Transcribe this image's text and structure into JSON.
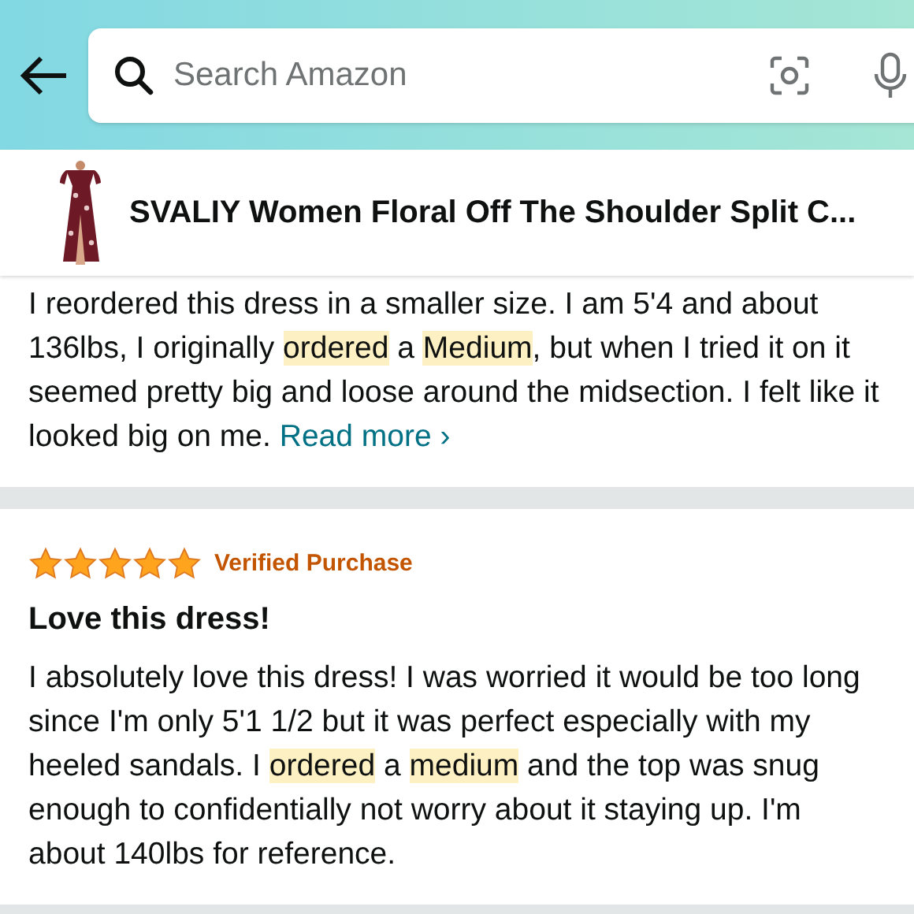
{
  "search": {
    "placeholder": "Search Amazon"
  },
  "product": {
    "title": "SVALIY Women Floral Off The Shoulder Split C..."
  },
  "reviews": [
    {
      "body": [
        {
          "text": "I reordered this dress in a smaller size. I am 5'4 and about 136lbs, I originally ",
          "highlight": false
        },
        {
          "text": "ordered",
          "highlight": true
        },
        {
          "text": " a ",
          "highlight": false
        },
        {
          "text": "Medium",
          "highlight": true
        },
        {
          "text": ", but when I tried it on it seemed pretty big and loose around the midsection. I felt like it looked big on me.",
          "highlight": false
        }
      ],
      "read_more": "Read more ›"
    },
    {
      "stars": 5,
      "badge": "Verified Purchase",
      "title": "Love this dress!",
      "body": [
        {
          "text": "I absolutely love this dress! I was worried it would be too long since I'm only 5'1 1/2 but it was perfect especially with my heeled sandals. I ",
          "highlight": false
        },
        {
          "text": "ordered",
          "highlight": true
        },
        {
          "text": " a ",
          "highlight": false
        },
        {
          "text": "medium",
          "highlight": true
        },
        {
          "text": " and the top was snug enough to confidentially not worry about it staying up. I'm about 140lbs for reference.",
          "highlight": false
        }
      ]
    }
  ]
}
